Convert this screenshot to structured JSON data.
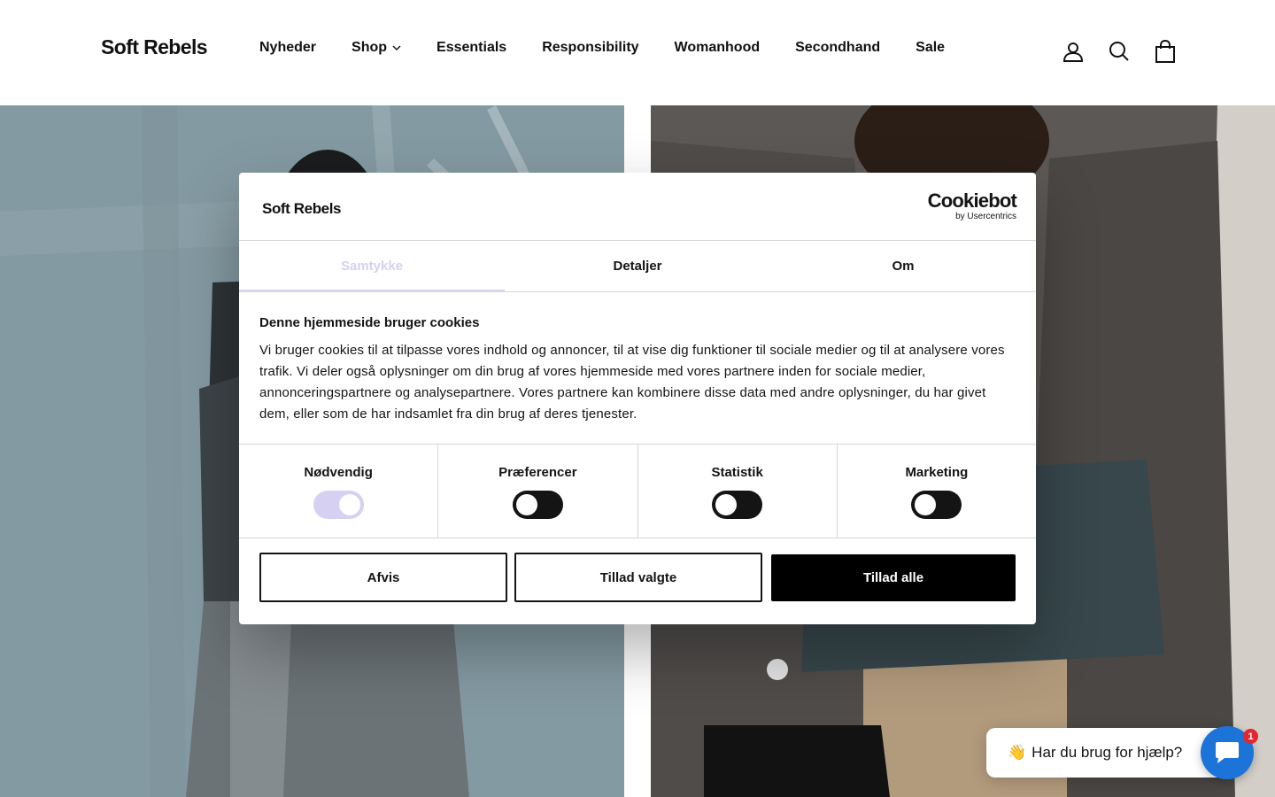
{
  "header": {
    "logo": "Soft Rebels",
    "nav": [
      {
        "label": "Nyheder"
      },
      {
        "label": "Shop",
        "has_dropdown": true
      },
      {
        "label": "Essentials"
      },
      {
        "label": "Responsibility"
      },
      {
        "label": "Womanhood"
      },
      {
        "label": "Secondhand"
      },
      {
        "label": "Sale"
      }
    ],
    "icons": [
      "account-icon",
      "search-icon",
      "cart-icon"
    ]
  },
  "hero": {
    "left_color": "#7d9199",
    "right_color": "#6d6864"
  },
  "cookie_dialog": {
    "logo": "Soft Rebels",
    "brand": {
      "name": "Cookiebot",
      "sub": "by Usercentrics"
    },
    "tabs": [
      {
        "label": "Samtykke",
        "active": true
      },
      {
        "label": "Detaljer",
        "active": false
      },
      {
        "label": "Om",
        "active": false
      }
    ],
    "title": "Denne hjemmeside bruger cookies",
    "text": "Vi bruger cookies til at tilpasse vores indhold og annoncer, til at vise dig funktioner til sociale medier og til at analysere vores trafik. Vi deler også oplysninger om din brug af vores hjemmeside med vores partnere inden for sociale medier, annonceringspartnere og analysepartnere. Vores partnere kan kombinere disse data med andre oplysninger, du har givet dem, eller som de har indsamlet fra din brug af deres tjenester.",
    "toggles": [
      {
        "label": "Nødvendig",
        "on": true
      },
      {
        "label": "Præferencer",
        "on": false
      },
      {
        "label": "Statistik",
        "on": false
      },
      {
        "label": "Marketing",
        "on": false
      }
    ],
    "buttons": {
      "reject": "Afvis",
      "allow_selected": "Tillad valgte",
      "allow_all": "Tillad alle"
    },
    "colors": {
      "accent": "#d6d0f3",
      "primary": "#000000"
    }
  },
  "chat": {
    "wave": "👋",
    "prompt": "Har du brug for hjælp?",
    "badge": "1",
    "launcher_color": "#1d74d8"
  }
}
